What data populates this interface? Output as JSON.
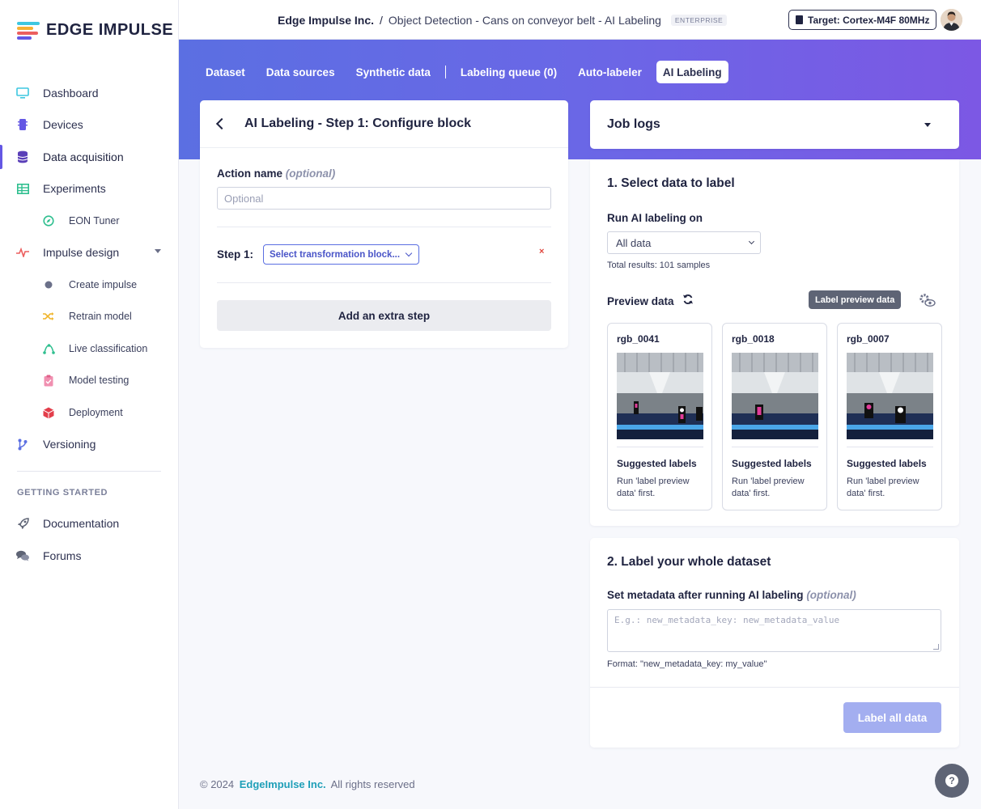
{
  "brand": {
    "name": "EDGE IMPULSE"
  },
  "sidebar": {
    "items": [
      {
        "label": "Dashboard",
        "icon": "monitor-icon"
      },
      {
        "label": "Devices",
        "icon": "chip-icon"
      },
      {
        "label": "Data acquisition",
        "icon": "database-icon"
      },
      {
        "label": "Experiments",
        "icon": "table-icon"
      },
      {
        "label": "EON Tuner",
        "icon": "compass-icon"
      },
      {
        "label": "Impulse design",
        "icon": "pulse-icon"
      },
      {
        "label": "Create impulse",
        "icon": "dot-icon"
      },
      {
        "label": "Retrain model",
        "icon": "shuffle-icon"
      },
      {
        "label": "Live classification",
        "icon": "network-icon"
      },
      {
        "label": "Model testing",
        "icon": "clipboard-check-icon"
      },
      {
        "label": "Deployment",
        "icon": "cube-icon"
      },
      {
        "label": "Versioning",
        "icon": "branch-icon"
      }
    ],
    "section_title": "GETTING STARTED",
    "getting_started": [
      {
        "label": "Documentation",
        "icon": "rocket-icon"
      },
      {
        "label": "Forums",
        "icon": "chat-icon"
      }
    ]
  },
  "header": {
    "org": "Edge Impulse Inc.",
    "separator": "/",
    "project": "Object Detection - Cans on conveyor belt - AI Labeling",
    "plan_badge": "ENTERPRISE",
    "target": "Target: Cortex-M4F 80MHz"
  },
  "tabs": [
    {
      "label": "Dataset"
    },
    {
      "label": "Data sources"
    },
    {
      "label": "Synthetic data"
    },
    {
      "label": "Labeling queue (0)"
    },
    {
      "label": "Auto-labeler"
    },
    {
      "label": "AI Labeling"
    }
  ],
  "config": {
    "title": "AI Labeling - Step 1: Configure block",
    "action_name_label": "Action name",
    "action_name_optional": "(optional)",
    "action_name_placeholder": "Optional",
    "step_label": "Step 1:",
    "step_select": "Select transformation block...",
    "remove": "×",
    "add_step": "Add an extra step"
  },
  "job_logs": {
    "title": "Job logs"
  },
  "select_data": {
    "title": "1. Select data to label",
    "run_on_label": "Run AI labeling on",
    "run_on_value": "All data",
    "total": "Total results: 101 samples",
    "preview_title": "Preview data",
    "label_preview_button": "Label preview data",
    "samples": [
      {
        "name": "rgb_0041",
        "suggested": "Suggested labels",
        "message": "Run 'label preview data' first."
      },
      {
        "name": "rgb_0018",
        "suggested": "Suggested labels",
        "message": "Run 'label preview data' first."
      },
      {
        "name": "rgb_0007",
        "suggested": "Suggested labels",
        "message": "Run 'label preview data' first."
      }
    ]
  },
  "label_all": {
    "title": "2. Label your whole dataset",
    "metadata_label": "Set metadata after running AI labeling",
    "metadata_optional": "(optional)",
    "metadata_placeholder": "E.g.: new_metadata_key: new_metadata_value",
    "format_hint": "Format: \"new_metadata_key: my_value\"",
    "button": "Label all data"
  },
  "footer": {
    "copyright": "© 2024",
    "company": "EdgeImpulse Inc.",
    "rights": "All rights reserved"
  },
  "colors": {
    "accent": "#6457e4",
    "banner_start": "#5b6fe2",
    "banner_end": "#7c58e4",
    "link": "#1f9fb8"
  }
}
